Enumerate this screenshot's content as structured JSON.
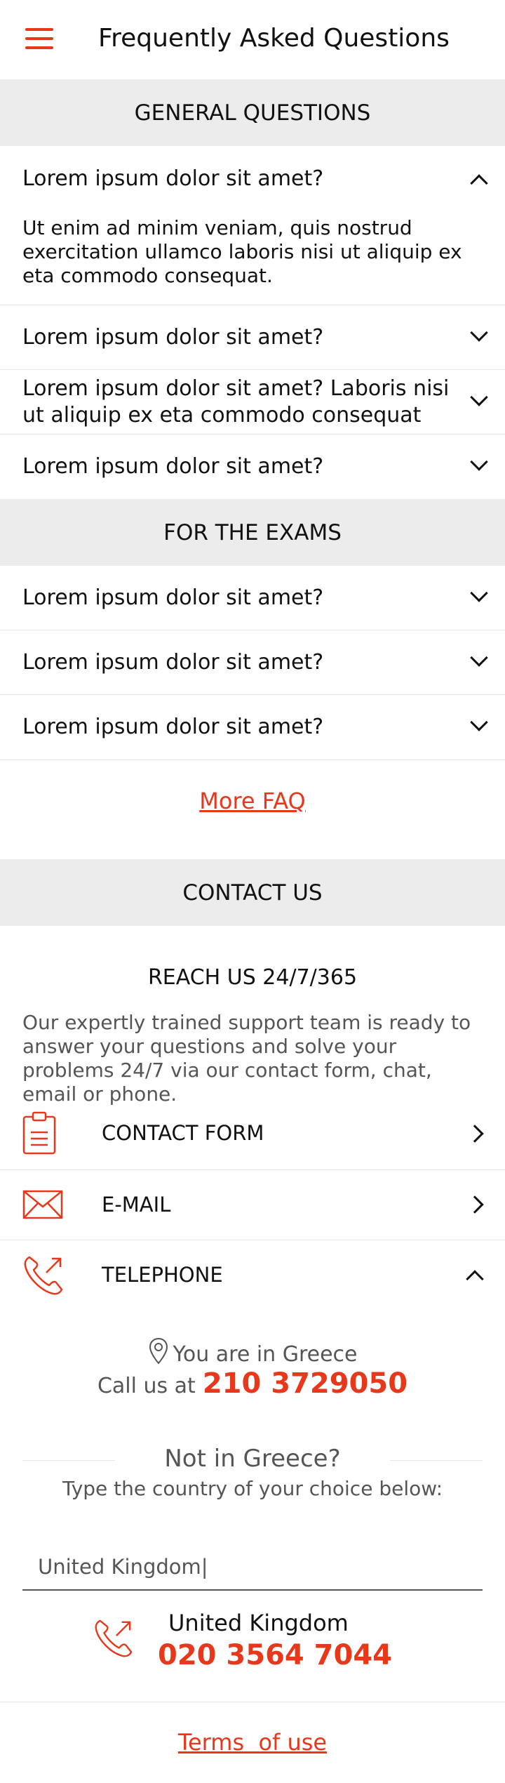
{
  "header": {
    "title": "Frequently Asked Questions",
    "menu_icon": "hamburger-menu-icon"
  },
  "accent_color": "#e8381b",
  "sections": {
    "general": "GENERAL QUESTIONS",
    "exams": "FOR THE EXAMS",
    "contact": "CONTACT US"
  },
  "general_faq": [
    {
      "question": "Lorem ipsum dolor sit amet?",
      "answer": "Ut enim ad minim veniam, quis nostrud exercitation ullamco laboris nisi ut aliquip ex eta commodo consequat.",
      "expanded": true
    },
    {
      "question": "Lorem ipsum dolor sit amet?",
      "expanded": false
    },
    {
      "question": "Lorem ipsum dolor sit amet? Laboris nisi ut aliquip ex eta commodo consequat",
      "expanded": false
    },
    {
      "question": "Lorem ipsum dolor sit amet?",
      "expanded": false
    }
  ],
  "exam_faq": [
    {
      "question": "Lorem ipsum dolor sit amet?",
      "expanded": false
    },
    {
      "question": "Lorem ipsum dolor sit amet?",
      "expanded": false
    },
    {
      "question": "Lorem ipsum dolor sit amet?",
      "expanded": false
    }
  ],
  "more_faq": "More FAQ",
  "contact": {
    "reach_title": "REACH US 24/7/365",
    "reach_text": "Our expertly trained support team is ready to answer your questions and solve your problems 24/7 via our contact form, chat, email or phone.",
    "options": [
      {
        "label": "CONTACT FORM",
        "icon": "clipboard-icon",
        "expanded": false
      },
      {
        "label": "E-MAIL",
        "icon": "envelope-icon",
        "expanded": false
      },
      {
        "label": "TELEPHONE",
        "icon": "phone-outgoing-icon",
        "expanded": true
      }
    ],
    "location_text": "You are in Greece",
    "call_prefix": "Call us at",
    "local_number": "210 3729050",
    "not_in_country": "Not in Greece?",
    "type_country_hint": "Type the country of your choice below:",
    "country_input_value": "United Kingdom|",
    "result_country": "United Kingdom",
    "result_number": "020 3564 7044"
  },
  "footer": {
    "terms": "Terms  of use"
  }
}
